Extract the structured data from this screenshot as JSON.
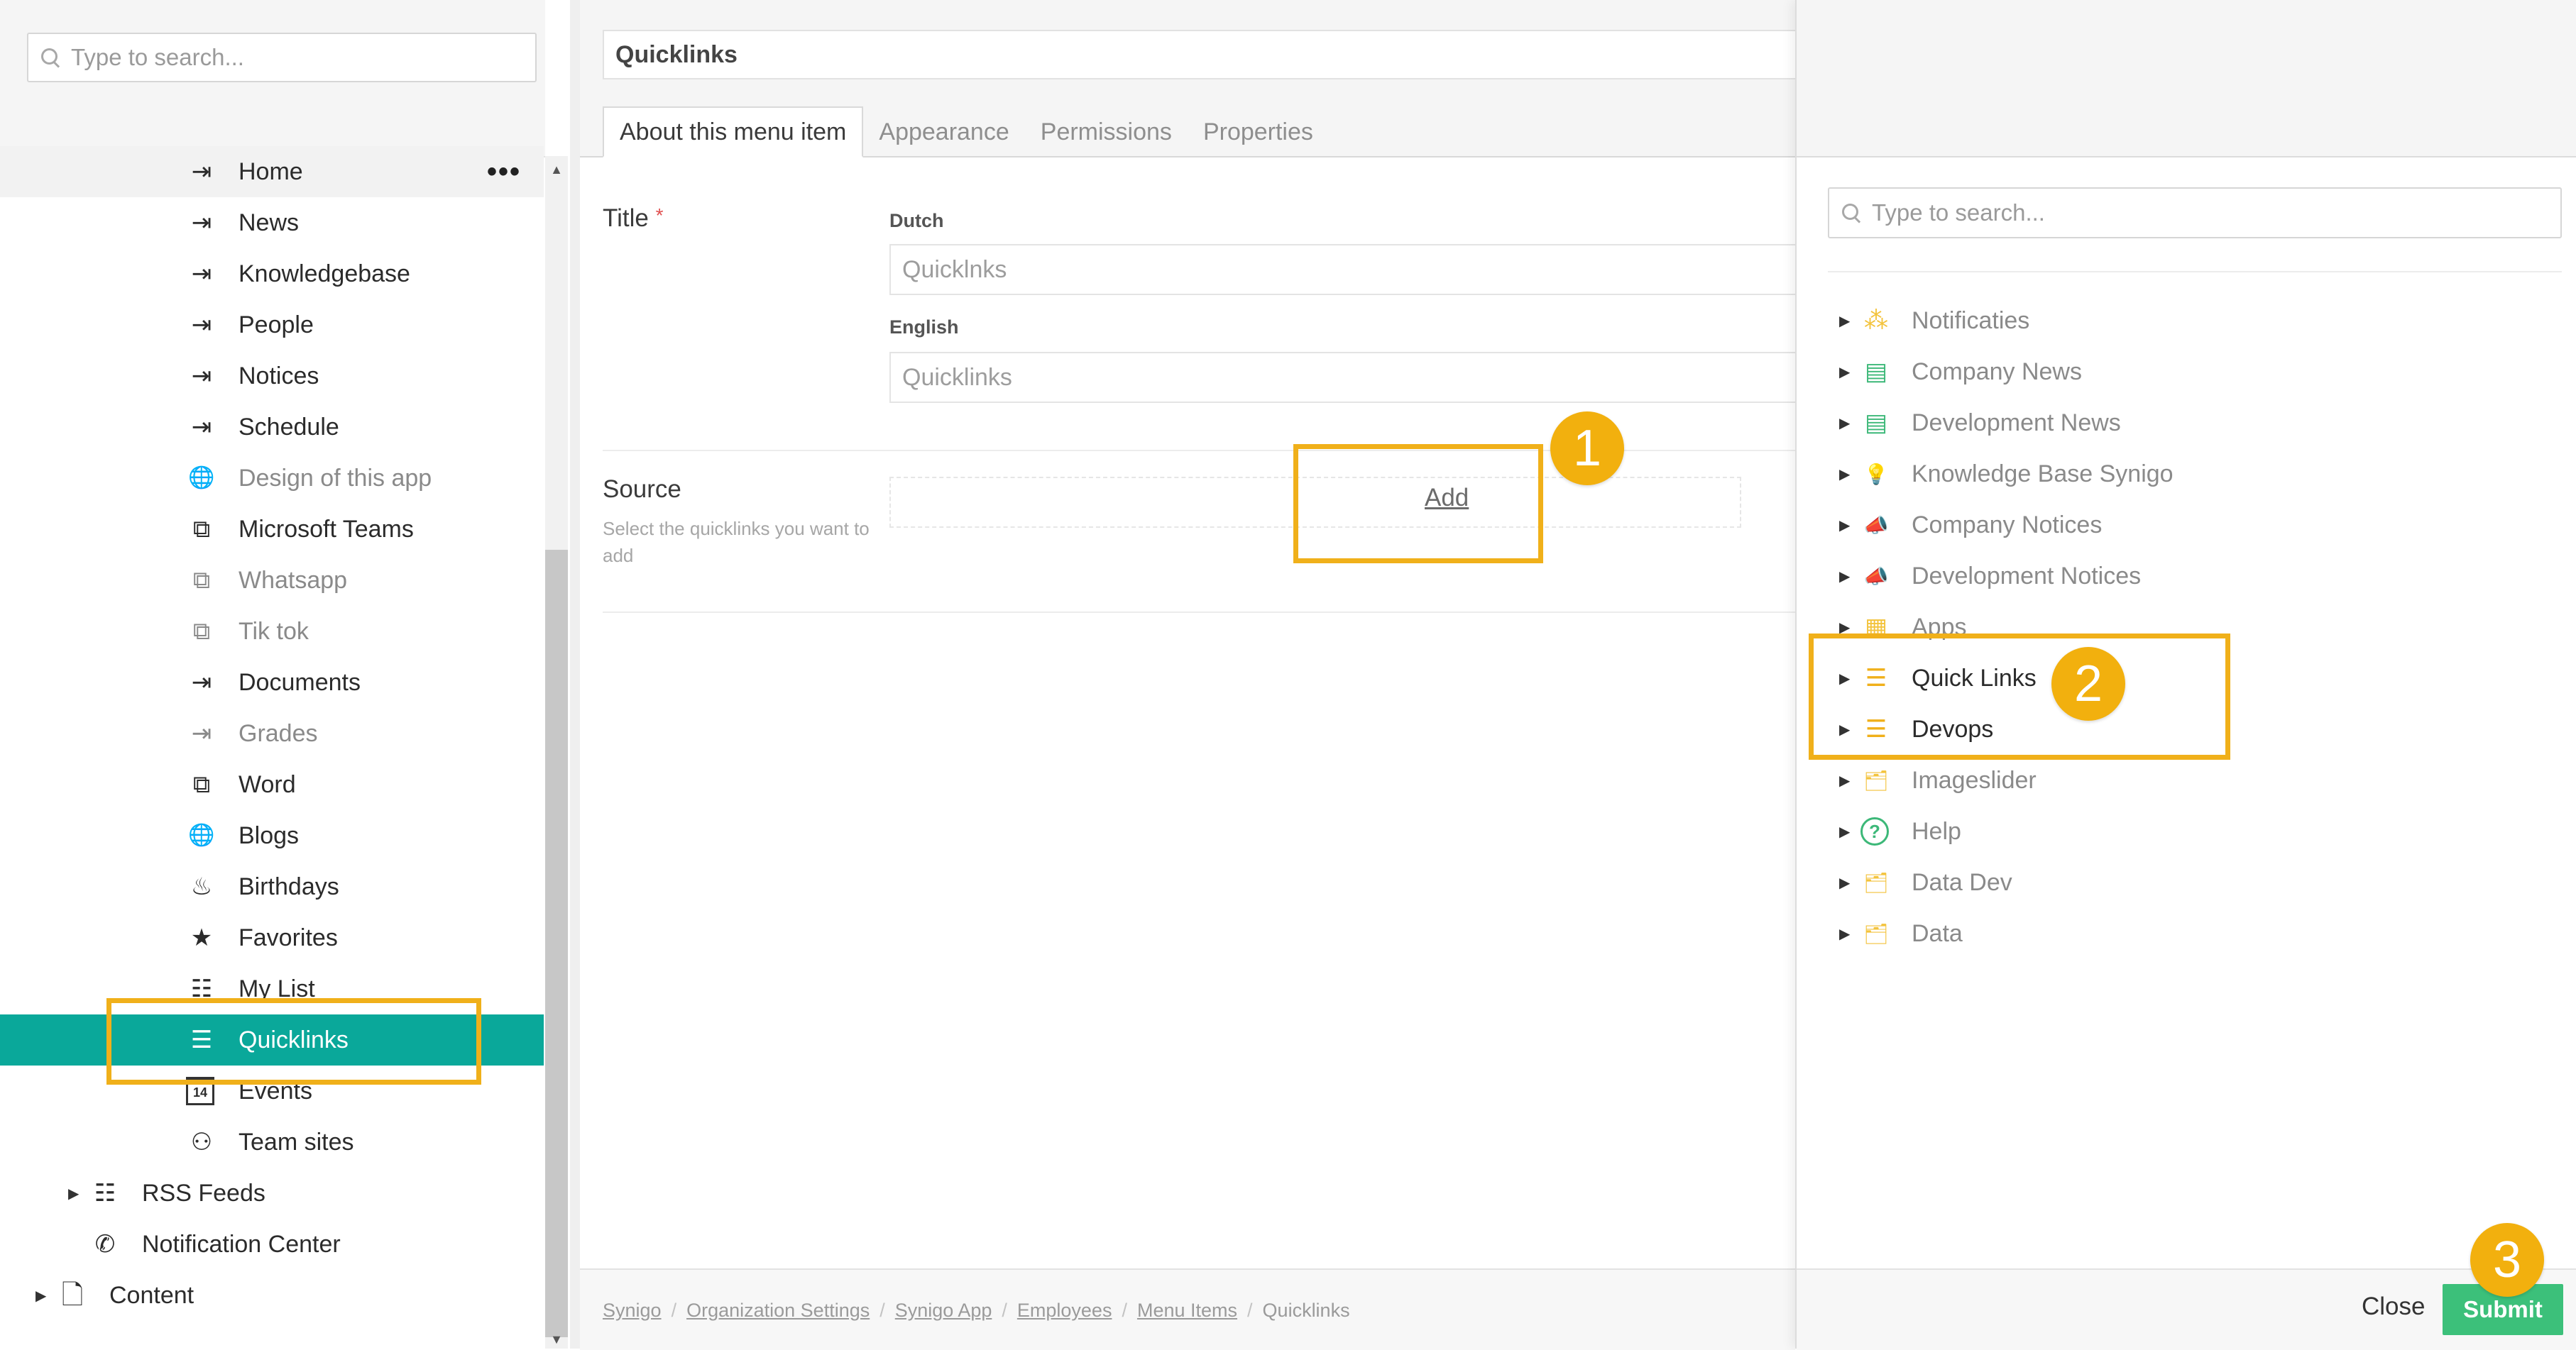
{
  "sidebar": {
    "search_placeholder": "Type to search...",
    "more_label": "•••",
    "items": [
      {
        "label": "Home",
        "icon": "shortcut-arrow-icon",
        "glyph": "⇥"
      },
      {
        "label": "News",
        "icon": "shortcut-arrow-icon",
        "glyph": "⇥"
      },
      {
        "label": "Knowledgebase",
        "icon": "shortcut-arrow-icon",
        "glyph": "⇥"
      },
      {
        "label": "People",
        "icon": "shortcut-arrow-icon",
        "glyph": "⇥"
      },
      {
        "label": "Notices",
        "icon": "shortcut-arrow-icon",
        "glyph": "⇥"
      },
      {
        "label": "Schedule",
        "icon": "shortcut-arrow-icon",
        "glyph": "⇥"
      },
      {
        "label": "Design of this app",
        "icon": "globe-icon",
        "glyph": "🌐"
      },
      {
        "label": "Microsoft Teams",
        "icon": "external-link-icon",
        "glyph": "⧉"
      },
      {
        "label": "Whatsapp",
        "icon": "external-link-icon",
        "glyph": "⧉"
      },
      {
        "label": "Tik tok",
        "icon": "external-link-icon",
        "glyph": "⧉"
      },
      {
        "label": "Documents",
        "icon": "shortcut-arrow-icon",
        "glyph": "⇥"
      },
      {
        "label": "Grades",
        "icon": "shortcut-arrow-icon",
        "glyph": "⇥"
      },
      {
        "label": "Word",
        "icon": "external-link-icon",
        "glyph": "⧉"
      },
      {
        "label": "Blogs",
        "icon": "globe-icon",
        "glyph": "🌐"
      },
      {
        "label": "Birthdays",
        "icon": "cake-icon",
        "glyph": "♨"
      },
      {
        "label": "Favorites",
        "icon": "star-icon",
        "glyph": "★"
      },
      {
        "label": "My List",
        "icon": "list-icon",
        "glyph": "☷"
      },
      {
        "label": "Quicklinks",
        "icon": "quicklinks-list-icon",
        "glyph": "☰"
      },
      {
        "label": "Events",
        "icon": "calendar-icon",
        "glyph": "14"
      },
      {
        "label": "Team sites",
        "icon": "sitemap-icon",
        "glyph": "⚇"
      },
      {
        "label": "RSS Feeds",
        "icon": "list-icon",
        "glyph": "☷"
      },
      {
        "label": "Notification Center",
        "icon": "phone-ring-icon",
        "glyph": "✆"
      },
      {
        "label": "Content",
        "icon": "document-icon",
        "glyph": "🗋"
      }
    ]
  },
  "form": {
    "header_title": "Quicklinks",
    "tabs": [
      "About this menu item",
      "Appearance",
      "Permissions",
      "Properties"
    ],
    "title_label": "Title",
    "required_mark": "*",
    "dutch_label": "Dutch",
    "dutch_value": "Quicklnks",
    "english_label": "English",
    "english_value": "Quicklinks",
    "source_label": "Source",
    "source_hint": "Select the quicklinks you want to add",
    "add_label": "Add"
  },
  "breadcrumb": [
    "Synigo",
    "Organization Settings",
    "Synigo App",
    "Employees",
    "Menu Items",
    "Quicklinks"
  ],
  "breadcrumb_sep": "/",
  "picker": {
    "search_placeholder": "Type to search...",
    "items": [
      {
        "label": "Notificaties",
        "icon": "notification-icon",
        "glyph": "⁂",
        "color": "#f3c33c"
      },
      {
        "label": "Company News",
        "icon": "newspaper-icon",
        "glyph": "▤",
        "color": "#3cb878"
      },
      {
        "label": "Development News",
        "icon": "newspaper-icon",
        "glyph": "▤",
        "color": "#3cb878"
      },
      {
        "label": "Knowledge Base Synigo",
        "icon": "lightbulb-icon",
        "glyph": "💡",
        "color": "#4cc7a6"
      },
      {
        "label": "Company Notices",
        "icon": "megaphone-icon",
        "glyph": "📣",
        "color": "#e45a5a"
      },
      {
        "label": "Development Notices",
        "icon": "megaphone-icon",
        "glyph": "📣",
        "color": "#e45a5a"
      },
      {
        "label": "Apps",
        "icon": "grid-icon",
        "glyph": "▦",
        "color": "#f3c33c"
      },
      {
        "label": "Quick Links",
        "icon": "quicklinks-list-icon",
        "glyph": "☰",
        "color": "#f0b01a"
      },
      {
        "label": "Devops",
        "icon": "quicklinks-list-icon",
        "glyph": "☰",
        "color": "#f0b01a"
      },
      {
        "label": "Imageslider",
        "icon": "image-folder-icon",
        "glyph": "🗂",
        "color": "#f3c33c"
      },
      {
        "label": "Help",
        "icon": "help-icon",
        "glyph": "?",
        "color": "#3cb878"
      },
      {
        "label": "Data Dev",
        "icon": "image-folder-icon",
        "glyph": "🗂",
        "color": "#f3c33c"
      },
      {
        "label": "Data",
        "icon": "image-folder-icon",
        "glyph": "🗂",
        "color": "#f3c33c"
      }
    ],
    "close_label": "Close",
    "submit_label": "Submit"
  },
  "annotations": {
    "step1": "1",
    "step2": "2",
    "step3": "3"
  },
  "colors": {
    "selected": "#0aa89a",
    "submit": "#3cc07a",
    "highlight": "#f0b01a"
  }
}
